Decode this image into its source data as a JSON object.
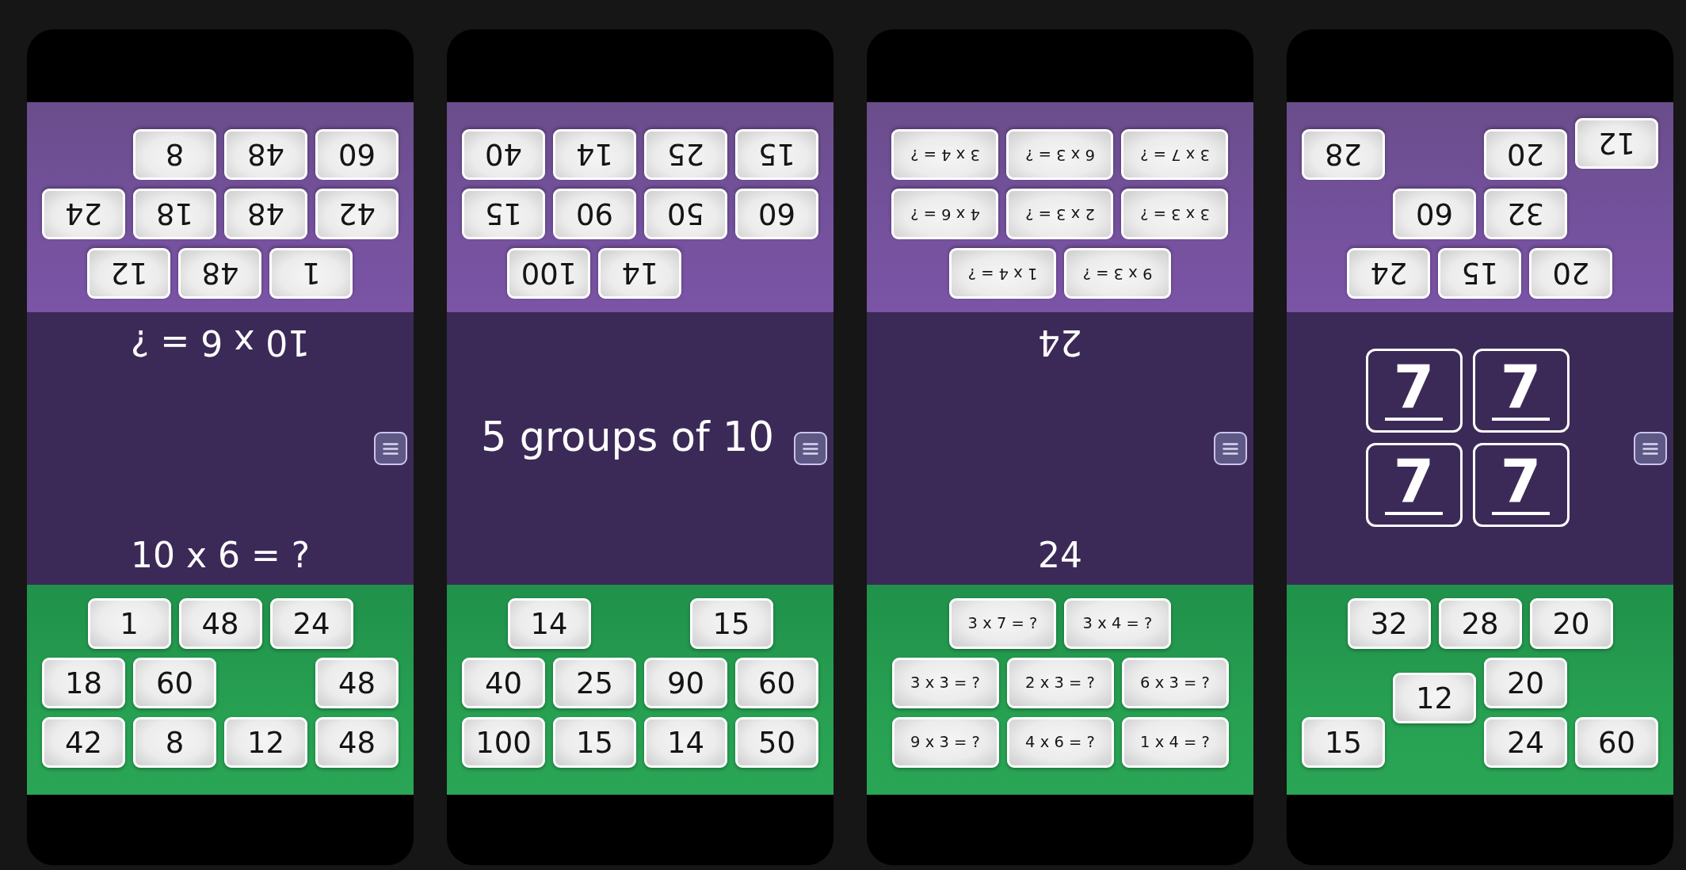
{
  "screens": [
    {
      "top_player": {
        "tiles": [
          "1",
          "48",
          "12",
          "42",
          "48",
          "18",
          "24",
          "60",
          "48",
          "8"
        ]
      },
      "center": {
        "kind": "split",
        "top_prompt": "10 x 6 = ?",
        "bottom_prompt": "10 x 6 = ?"
      },
      "bottom_player": {
        "tiles": [
          "1",
          "48",
          "24",
          "18",
          "60",
          "48",
          "42",
          "8",
          "12",
          "48"
        ]
      }
    },
    {
      "top_player": {
        "tiles": [
          "14",
          "100",
          "60",
          "50",
          "90",
          "15",
          "15",
          "25",
          "14",
          "40"
        ]
      },
      "center": {
        "kind": "single",
        "prompt": "5 groups of 10"
      },
      "bottom_player": {
        "tiles": [
          "14",
          "15",
          "40",
          "25",
          "90",
          "60",
          "100",
          "15",
          "14",
          "50"
        ]
      }
    },
    {
      "top_player": {
        "tiles": [
          "9 x 3 = ?",
          "1 x 4 = ?",
          "3 x 3 = ?",
          "2 x 3 = ?",
          "4 x 6 = ?",
          "3 x 7 = ?",
          "6 x 3 = ?",
          "3 x 4 = ?"
        ]
      },
      "center": {
        "kind": "split",
        "top_prompt": "24",
        "bottom_prompt": "24"
      },
      "bottom_player": {
        "tiles": [
          "3 x 7 = ?",
          "3 x 4 = ?",
          "3 x 3 = ?",
          "2 x 3 = ?",
          "6 x 3 = ?",
          "9 x 3 = ?",
          "4 x 6 = ?",
          "1 x 4 = ?"
        ]
      }
    },
    {
      "top_player": {
        "tiles": [
          "20",
          "15",
          "24",
          "32",
          "60",
          "12",
          "20",
          "28"
        ]
      },
      "center": {
        "kind": "cards",
        "cards": [
          "7",
          "7",
          "7",
          "7"
        ]
      },
      "bottom_player": {
        "tiles": [
          "32",
          "28",
          "20",
          "12",
          "20",
          "15",
          "24",
          "60"
        ]
      }
    }
  ]
}
